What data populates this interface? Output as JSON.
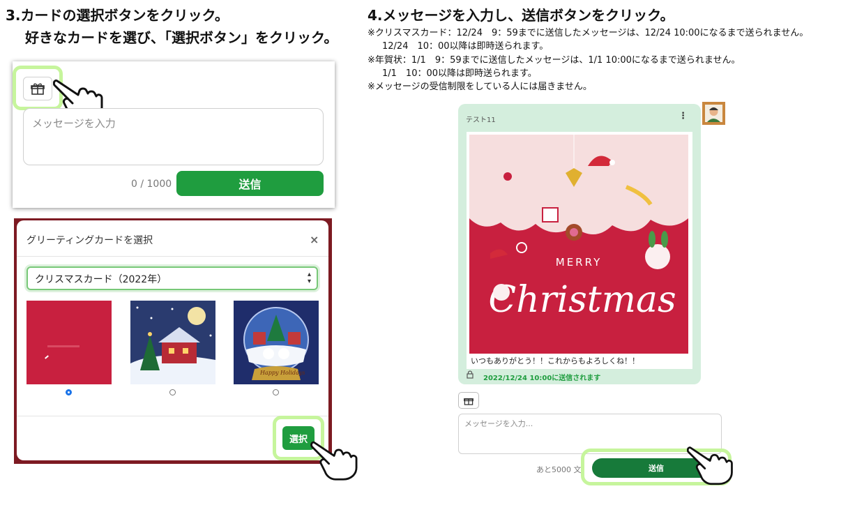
{
  "step3": {
    "title": "3.カードの選択ボタンをクリック。",
    "subtitle": "好きなカードを選び、「選択ボタン」をクリック。"
  },
  "composer": {
    "gift_icon": "gift-icon",
    "placeholder": "メッセージを入力",
    "counter": "0 / 1000",
    "send_label": "送信"
  },
  "modal": {
    "title": "グリーティングカードを選択",
    "close": "×",
    "select_value": "クリスマスカード（2022年）",
    "select_arrows": "▲▼",
    "cards": [
      {
        "name": "red-card",
        "selected": true
      },
      {
        "name": "snow-house-card",
        "selected": false
      },
      {
        "name": "snow-globe-card",
        "selected": false
      }
    ],
    "select_button": "選択",
    "globe_caption": "Happy Holidays"
  },
  "step4": {
    "title": "4.メッセージを入力し、送信ボタンをクリック。",
    "notes": [
      "※クリスマスカード：12/24　9：59までに送信したメッセージは、12/24 10:00になるまで送られません。",
      "12/24　10：00以降は即時送られます。",
      "※年賀状：1/1　9：59までに送信したメッセージは、1/1 10:00になるまで送られません。",
      "1/1　10：00以降は即時送られます。",
      "※メッセージの受信制限をしている人には届きません。"
    ]
  },
  "chat": {
    "sender": "テスト11",
    "menu": "⋮",
    "card_text": "MERRY",
    "card_script": "Christmas",
    "caption": "いつもありがとう！！これからもよろしくね！！",
    "schedule": "2022/12/24 10:00に送信されます",
    "lock_icon": "lock-icon",
    "gift_icon": "gift-icon",
    "placeholder": "メッセージを入力...",
    "counter": "あと5000 文",
    "send_label": "送信"
  },
  "colors": {
    "accent_green": "#1f9d3f",
    "highlight": "#c6f59c",
    "card_red": "#c8203f",
    "bubble": "#d4eedd"
  }
}
